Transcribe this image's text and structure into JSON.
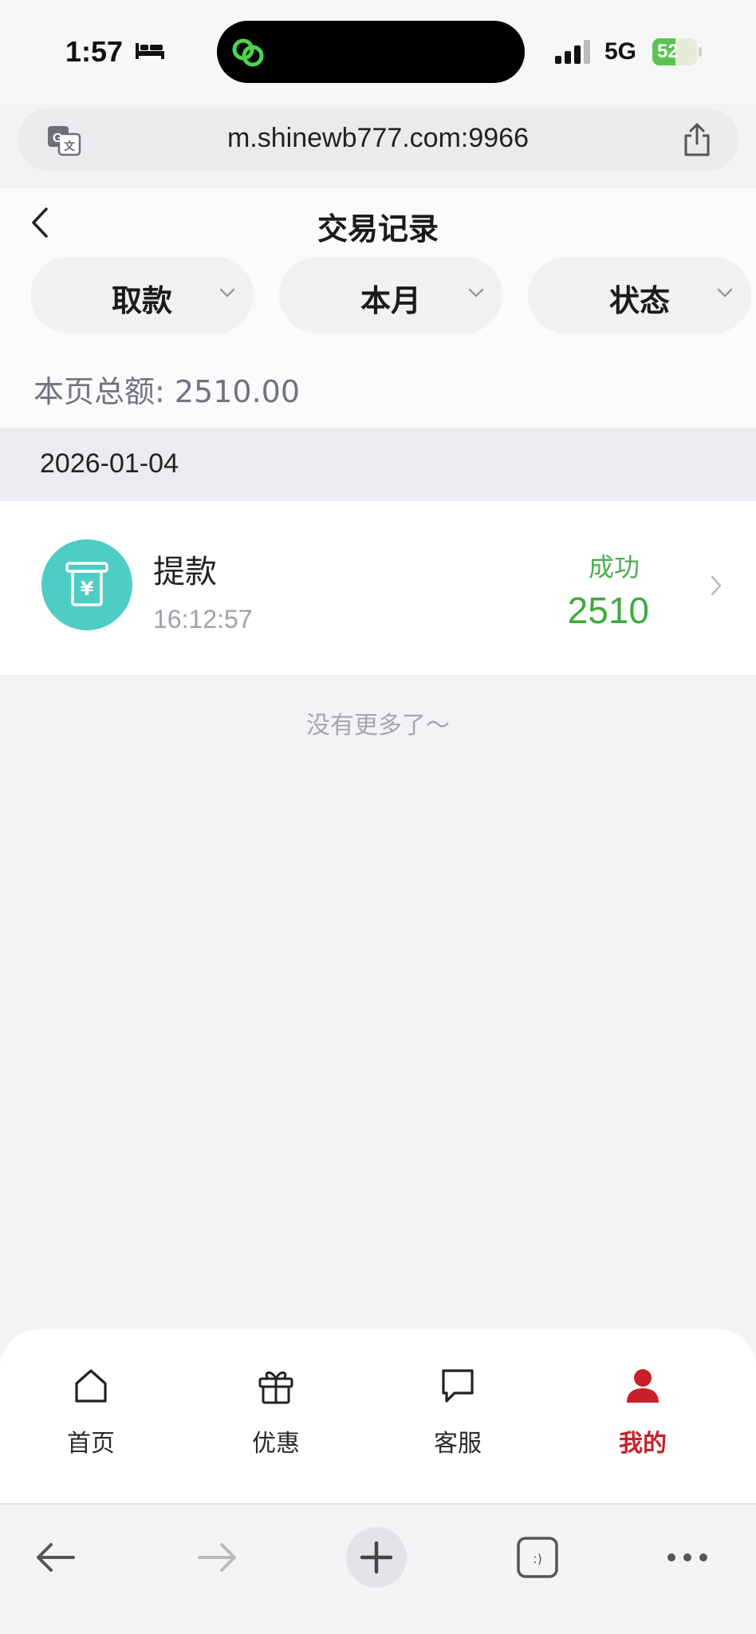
{
  "status_bar": {
    "time": "1:57",
    "network": "5G",
    "battery": "52",
    "battery_level": 0.52
  },
  "browser": {
    "url": "m.shinewb777.com:9966"
  },
  "header": {
    "title": "交易记录"
  },
  "filters": [
    {
      "label": "取款"
    },
    {
      "label": "本月"
    },
    {
      "label": "状态"
    }
  ],
  "summary": {
    "text": "本页总额: 2510.00"
  },
  "records": [
    {
      "date": "2026-01-04",
      "title": "提款",
      "time": "16:12:57",
      "status": "成功",
      "amount": "2510"
    }
  ],
  "no_more_text": "没有更多了～",
  "tabs": [
    {
      "label": "首页",
      "icon": "home-icon",
      "active": false
    },
    {
      "label": "优惠",
      "icon": "gift-icon",
      "active": false
    },
    {
      "label": "客服",
      "icon": "chat-icon",
      "active": false
    },
    {
      "label": "我的",
      "icon": "user-icon",
      "active": true
    }
  ],
  "colors": {
    "accent_red": "#c8202a",
    "success_green": "#4caf50",
    "avatar_teal": "#4ecdc4"
  }
}
